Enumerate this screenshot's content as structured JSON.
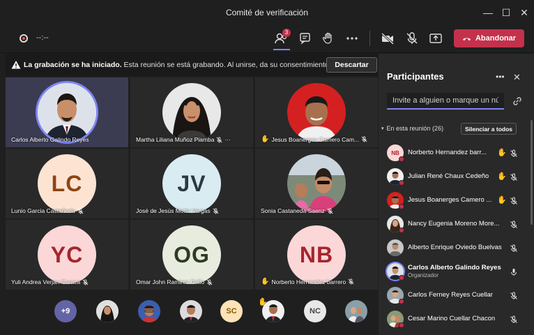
{
  "window": {
    "title": "Comité de verificación"
  },
  "toolbar": {
    "recording_time": "--:--",
    "participants_badge": "3",
    "leave_label": "Abandonar"
  },
  "banner": {
    "bold": "La grabación se ha iniciado.",
    "text": "Esta reunión se está grabando. Al unirse, da su consentimiento...",
    "dismiss_label": "Descartar"
  },
  "tiles": [
    {
      "name": "Carlos Alberto Galindo Reyes",
      "kind": "photo",
      "icon": "face-man-suit-icon",
      "speaking": true,
      "mic": "none",
      "hand": false
    },
    {
      "name": "Martha Liliana Muñoz Piamba",
      "kind": "photo",
      "icon": "face-woman-icon",
      "speaking": false,
      "mic": "muted",
      "hand": false,
      "more": "···"
    },
    {
      "name": "Jesus Boanerges Camero Cam...",
      "kind": "photo",
      "icon": "face-man-red-icon",
      "speaking": false,
      "mic": "muted",
      "hand": true
    },
    {
      "name": "Lunio Garcia Castañeda",
      "kind": "initials",
      "initials": "LC",
      "bg": "#fde3d2",
      "fg": "#8b4513",
      "mic": "muted",
      "hand": false
    },
    {
      "name": "José de Jesús Motta Vargas",
      "kind": "initials",
      "initials": "JV",
      "bg": "#d9ecf2",
      "fg": "#2b3a3f",
      "mic": "muted",
      "hand": false
    },
    {
      "name": "Sonia Castaneda Saenz",
      "kind": "photo",
      "icon": "face-woman-group-icon",
      "speaking": false,
      "mic": "muted",
      "hand": false
    },
    {
      "name": "Yuli Andrea Verjan Curaca",
      "kind": "initials",
      "initials": "YC",
      "bg": "#fbd7d7",
      "fg": "#a4262c",
      "mic": "muted",
      "hand": false
    },
    {
      "name": "Omar John Ramirez Grillo",
      "kind": "initials",
      "initials": "OG",
      "bg": "#e7ecdf",
      "fg": "#2f3a1f",
      "mic": "muted",
      "hand": false
    },
    {
      "name": "Norberto Hernandez barrero",
      "kind": "initials",
      "initials": "NB",
      "bg": "#fbd7d7",
      "fg": "#a4262c",
      "mic": "muted",
      "hand": true
    }
  ],
  "strip": {
    "more_label": "+9",
    "sc_initials": "SC",
    "nc_initials": "NC"
  },
  "panel": {
    "title": "Participantes",
    "invite_placeholder": "Invite a alguien o marque un núme",
    "section_label": "En esta reunión (26)",
    "mute_all_label": "Silenciar a todos",
    "participants": [
      {
        "name": "Norberto Hernandez barr...",
        "initials": "NB",
        "hand": true,
        "mic": "muted"
      },
      {
        "name": "Julian René Chaux Cedeño",
        "hand": true,
        "mic": "muted"
      },
      {
        "name": "Jesus Boanerges Camero ...",
        "hand": true,
        "mic": "muted"
      },
      {
        "name": "Nancy Eugenia Moreno More...",
        "hand": false,
        "mic": "muted"
      },
      {
        "name": "Alberto Enrique Oviedo Buelvas",
        "hand": false,
        "mic": "muted"
      },
      {
        "name": "Carlos Alberto Galindo Reyes",
        "role": "Organizador",
        "hand": false,
        "mic": "on"
      },
      {
        "name": "Carlos Ferney Reyes Cuellar",
        "hand": false,
        "mic": "muted"
      },
      {
        "name": "Cesar Marino Cuellar Chacon",
        "hand": false,
        "mic": "muted"
      }
    ]
  },
  "colors": {
    "accent": "#7f85f5",
    "leave": "#c4314b",
    "hand": "#f2b90f",
    "panel_bg": "#292929",
    "app_bg": "#1f1f1f"
  }
}
